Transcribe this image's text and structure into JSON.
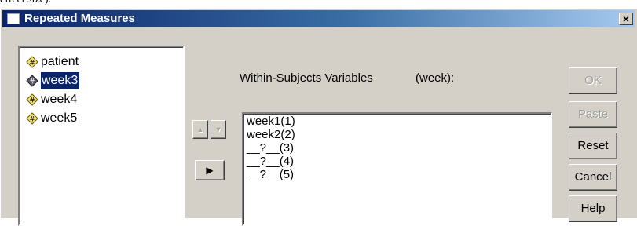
{
  "top_clip_text": "effect size).",
  "window": {
    "title": "Repeated Measures",
    "close_glyph": "×"
  },
  "variables": [
    {
      "name": "patient",
      "selected": false
    },
    {
      "name": "week3",
      "selected": true
    },
    {
      "name": "week4",
      "selected": false
    },
    {
      "name": "week5",
      "selected": false
    }
  ],
  "within": {
    "label": "Within-Subjects Variables",
    "factor": "(week):",
    "items": [
      "week1(1)",
      "week2(2)",
      "__?__(3)",
      "__?__(4)",
      "__?__(5)"
    ]
  },
  "arrows": {
    "up": "▲",
    "down": "▼",
    "move": "▶"
  },
  "buttons": {
    "ok": "OK",
    "paste": "Paste",
    "reset": "Reset",
    "cancel": "Cancel",
    "help": "Help"
  },
  "colors": {
    "title_start": "#0a246a",
    "title_end": "#a6caf0",
    "selection": "#0a246a",
    "dialog_bg": "#d4d0c8"
  }
}
